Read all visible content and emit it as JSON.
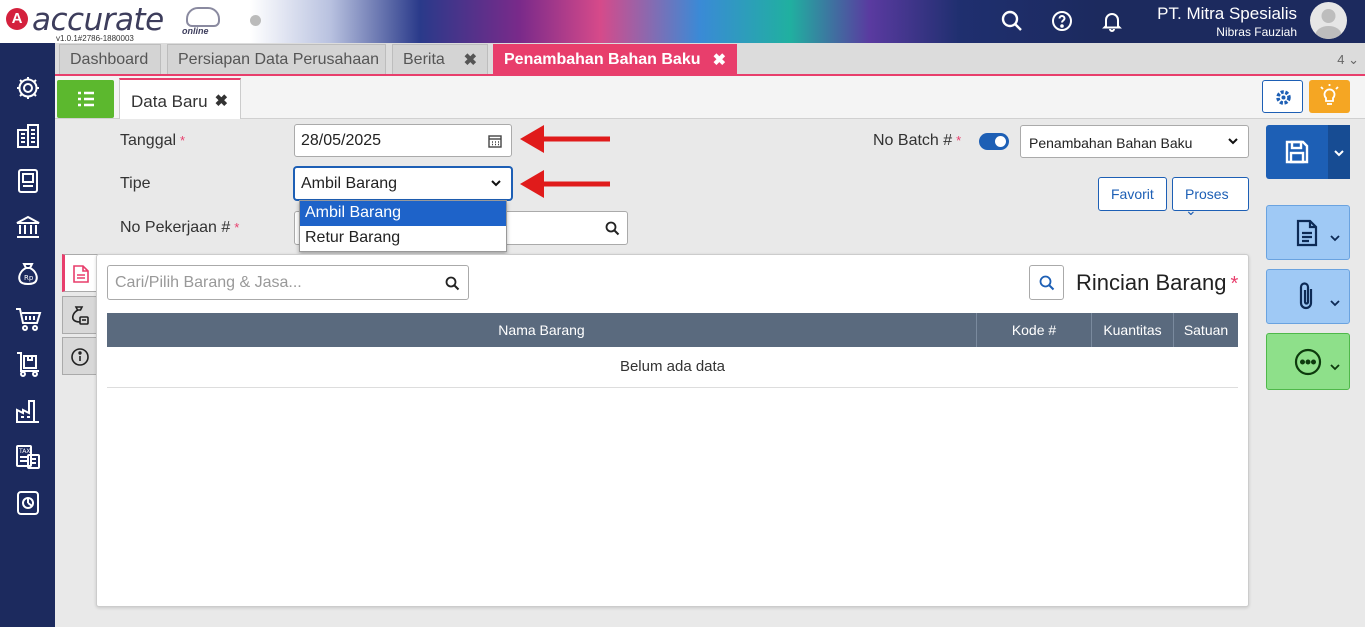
{
  "app": {
    "logo_text": "accurate",
    "logo_sub": "online",
    "version": "v1.0.1#2786-1880003"
  },
  "header": {
    "company": "PT. Mitra Spesialis",
    "user": "Nibras Fauziah",
    "icons": [
      "search-icon",
      "help-icon",
      "bell-icon",
      "avatar"
    ]
  },
  "sidebar": {
    "icons": [
      "settings-icon",
      "building-icon",
      "ledger-icon",
      "bank-icon",
      "money-bag-icon",
      "cart-icon",
      "inventory-icon",
      "factory-icon",
      "tax-icon",
      "report-icon"
    ]
  },
  "tabs": [
    {
      "label": "Dashboard"
    },
    {
      "label": "Persiapan Data Perusahaan"
    },
    {
      "label": "Berita"
    },
    {
      "label": "Penambahan Bahan Baku"
    }
  ],
  "tab_count": "4",
  "subtab": {
    "label": "Data Baru"
  },
  "form": {
    "tanggal_label": "Tanggal",
    "tanggal_value": "28/05/2025",
    "tipe_label": "Tipe",
    "tipe_value": "Ambil Barang",
    "tipe_options": [
      "Ambil Barang",
      "Retur Barang"
    ],
    "no_pekerjaan_label": "No Pekerjaan #",
    "no_batch_label": "No Batch #",
    "no_batch_value": "Penambahan Bahan Baku",
    "required_mark": "*",
    "favorit_label": "Favorit",
    "proses_label": "Proses"
  },
  "panel": {
    "search_placeholder": "Cari/Pilih Barang & Jasa...",
    "title": "Rincian Barang",
    "columns": [
      "Nama Barang",
      "Kode #",
      "Kuantitas",
      "Satuan"
    ],
    "empty_text": "Belum ada data"
  },
  "colors": {
    "accent": "#e83e6c",
    "primary": "#1d5fb5",
    "sidebar": "#1c2a5e",
    "green": "#5cb82e"
  }
}
